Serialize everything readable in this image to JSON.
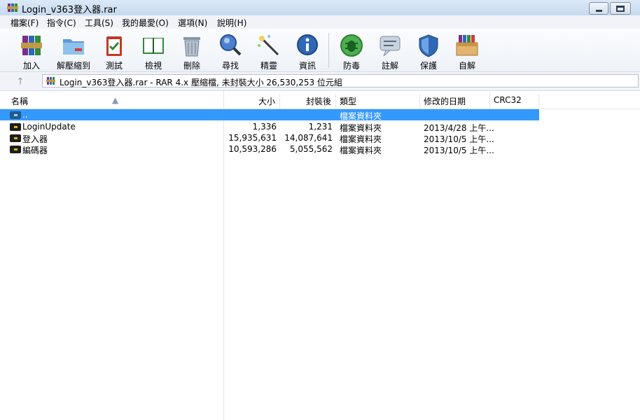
{
  "window": {
    "title": "Login_v363登入器.rar"
  },
  "menu": [
    "檔案(F)",
    "指令(C)",
    "工具(S)",
    "我的最愛(O)",
    "選項(N)",
    "說明(H)"
  ],
  "toolbar": {
    "add": "加入",
    "extract": "解壓縮到",
    "test": "測試",
    "view": "檢視",
    "delete": "刪除",
    "find": "尋找",
    "wizard": "精靈",
    "info": "資訊",
    "virus": "防毒",
    "comment": "註解",
    "protect": "保護",
    "sfx": "自解"
  },
  "address": {
    "path": "Login_v363登入器.rar - RAR 4.x 壓縮檔, 未封裝大小 26,530,253 位元組"
  },
  "columns": {
    "name": "名稱",
    "size": "大小",
    "packed": "封裝後",
    "type": "類型",
    "modified": "修改的日期",
    "crc": "CRC32"
  },
  "rows": [
    {
      "name": "..",
      "size": "",
      "packed": "",
      "type": "檔案資料夾",
      "modified": ""
    },
    {
      "name": "LoginUpdate",
      "size": "1,336",
      "packed": "1,231",
      "type": "檔案資料夾",
      "modified": "2013/4/28 上午..."
    },
    {
      "name": "登入器",
      "size": "15,935,631",
      "packed": "14,087,641",
      "type": "檔案資料夾",
      "modified": "2013/10/5 上午..."
    },
    {
      "name": "編碼器",
      "size": "10,593,286",
      "packed": "5,055,562",
      "type": "檔案資料夾",
      "modified": "2013/10/5 上午..."
    }
  ],
  "colors": {
    "selection": "#3399ff",
    "titlebar": "#c6daf0"
  }
}
